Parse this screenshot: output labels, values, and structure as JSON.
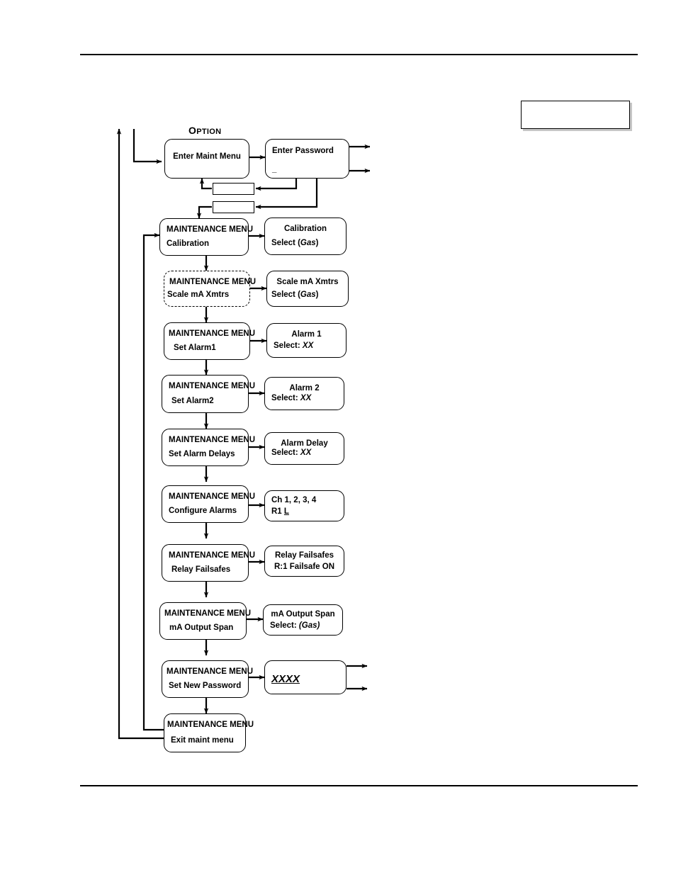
{
  "page": {
    "title": "Maintenance Menu Flowchart",
    "option_label_first": "O",
    "option_label_rest": "PTION",
    "note_box_text": ""
  },
  "top_row": {
    "enter_maint_menu": {
      "line1": "Enter Maint Menu",
      "line2": ""
    },
    "enter_password": {
      "line1": "Enter Password",
      "line2": "_"
    },
    "mini_box_1": "",
    "mini_box_2": ""
  },
  "menu_items": [
    {
      "id": "calibration",
      "left": {
        "line1": "MAINTENANCE  MENU",
        "line2": "Calibration",
        "dashed": false
      },
      "right": {
        "line1": "Calibration",
        "line2_prefix": "Select (",
        "line2_italic": "Gas",
        "line2_suffix": ")"
      }
    },
    {
      "id": "scale-ma-xmtrs",
      "left": {
        "line1": "MAINTENANCE  MENU",
        "line2": "Scale mA  Xmtrs",
        "dashed": true
      },
      "right": {
        "line1": "Scale mA Xmtrs",
        "line2_prefix": "Select (",
        "line2_italic": "Gas",
        "line2_suffix": ")"
      }
    },
    {
      "id": "set-alarm1",
      "left": {
        "line1": "MAINTENANCE  MENU",
        "line2": "Set Alarm1",
        "dashed": false
      },
      "right": {
        "line1": "Alarm 1",
        "line2_prefix": "Select: ",
        "line2_italic": "XX",
        "line2_suffix": ""
      }
    },
    {
      "id": "set-alarm2",
      "left": {
        "line1": "MAINTENANCE  MENU",
        "line2": "Set Alarm2",
        "dashed": false
      },
      "right": {
        "line1": "Alarm 2",
        "line2_prefix": "Select: ",
        "line2_italic": "XX",
        "line2_suffix": ""
      }
    },
    {
      "id": "set-alarm-delays",
      "left": {
        "line1": "MAINTENANCE  MENU",
        "line2": "Set Alarm Delays",
        "dashed": false
      },
      "right": {
        "line1": "Alarm Delay",
        "line2_prefix": "Select: ",
        "line2_italic": "XX",
        "line2_suffix": ""
      }
    },
    {
      "id": "configure-alarms",
      "left": {
        "line1": "MAINTENANCE  MENU",
        "line2": "Configure Alarms",
        "dashed": false
      },
      "right": {
        "line1": "Ch 1, 2, 3, 4",
        "line2_prefix": "R1 ",
        "line2_underline": "L",
        "line2_suffix": ""
      }
    },
    {
      "id": "relay-failsafes",
      "left": {
        "line1": "MAINTENANCE  MENU",
        "line2": "Relay Failsafes",
        "dashed": false
      },
      "right": {
        "line1": "Relay Failsafes",
        "line2_prefix": "R:1 Failsafe ON",
        "line2_suffix": ""
      }
    },
    {
      "id": "ma-output-span",
      "left": {
        "line1": "MAINTENANCE  MENU",
        "line2": "mA Output Span",
        "dashed": false
      },
      "right": {
        "line1": "mA Output Span",
        "line2_prefix": "Select: ",
        "line2_italic": "(Gas)",
        "line2_suffix": ""
      }
    },
    {
      "id": "set-new-password",
      "left": {
        "line1": "MAINTENANCE  MENU",
        "line2": "Set New Password",
        "dashed": false
      },
      "right": {
        "line1": "",
        "line2_italic": "XXXX",
        "line2_suffix": ""
      }
    },
    {
      "id": "exit-maint-menu",
      "left": {
        "line1": "MAINTENANCE  MENU",
        "line2": "Exit maint menu",
        "dashed": false
      },
      "right": null
    }
  ],
  "colors": {
    "ink": "#000000",
    "paper": "#ffffff"
  }
}
